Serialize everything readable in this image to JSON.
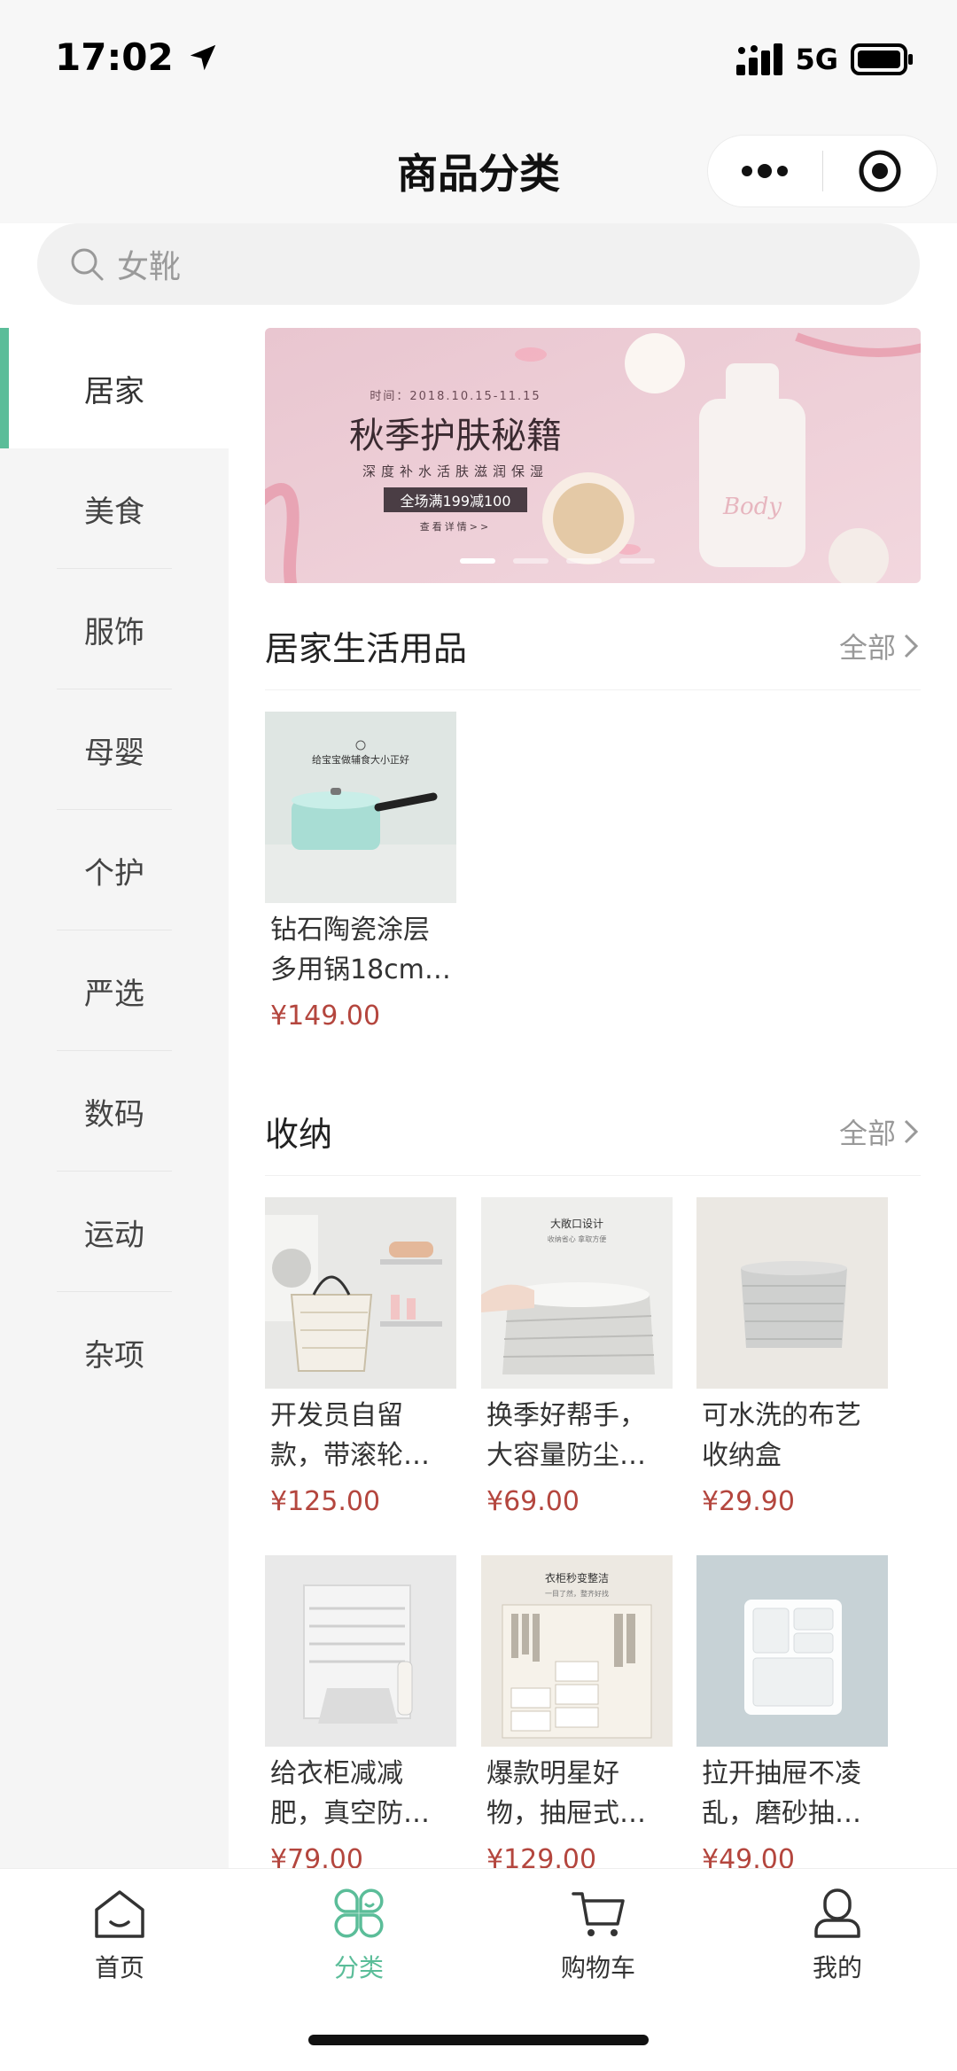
{
  "status_bar": {
    "time": "17:02",
    "network": "5G",
    "icons": [
      "location-arrow-icon",
      "signal-icon",
      "battery-icon"
    ]
  },
  "nav": {
    "title": "商品分类",
    "capsule_icons": [
      "more-dots-icon",
      "close-target-icon"
    ]
  },
  "search": {
    "placeholder": "女靴",
    "icon": "search-icon"
  },
  "sidebar": {
    "accent": "#5bbd99",
    "items": [
      {
        "label": "居家",
        "active": true
      },
      {
        "label": "美食"
      },
      {
        "label": "服饰"
      },
      {
        "label": "母婴"
      },
      {
        "label": "个护"
      },
      {
        "label": "严选"
      },
      {
        "label": "数码"
      },
      {
        "label": "运动"
      },
      {
        "label": "杂项"
      }
    ]
  },
  "banner": {
    "date_line": "时间：2018.10.15-11.15",
    "headline": "秋季护肤秘籍",
    "subline": "深度补水活肤滋润保湿",
    "promo": "全场满199减100",
    "link": "查看详情>>",
    "pager_count": 4,
    "pager_active": 0
  },
  "sections": [
    {
      "title": "居家生活用品",
      "more": "全部",
      "products": [
        {
          "name": "钻石陶瓷涂层多用锅18cm…",
          "price": "¥149.00",
          "thumb_caption": "给宝宝做辅食大小正好"
        }
      ]
    },
    {
      "title": "收纳",
      "more": "全部",
      "products": [
        {
          "name": "开发员自留款，带滚轮…",
          "price": "¥125.00"
        },
        {
          "name": "换季好帮手，大容量防尘…",
          "price": "¥69.00",
          "thumb_caption": "大敞口设计",
          "thumb_sub": "收纳省心 拿取方便"
        },
        {
          "name": "可水洗的布艺收纳盒",
          "price": "¥29.90"
        },
        {
          "name": "给衣柜减减肥，真空防…",
          "price": "¥79.00"
        },
        {
          "name": "爆款明星好物，抽屉式…",
          "price": "¥129.00",
          "thumb_caption": "衣柜秒变整洁",
          "thumb_sub": "一目了然，整齐好找"
        },
        {
          "name": "拉开抽屉不凌乱，磨砂抽…",
          "price": "¥49.00"
        }
      ]
    }
  ],
  "tabbar": {
    "active_color": "#5bbd99",
    "items": [
      {
        "label": "首页",
        "icon": "home-icon"
      },
      {
        "label": "分类",
        "icon": "category-icon",
        "active": true
      },
      {
        "label": "购物车",
        "icon": "cart-icon"
      },
      {
        "label": "我的",
        "icon": "user-icon"
      }
    ]
  }
}
